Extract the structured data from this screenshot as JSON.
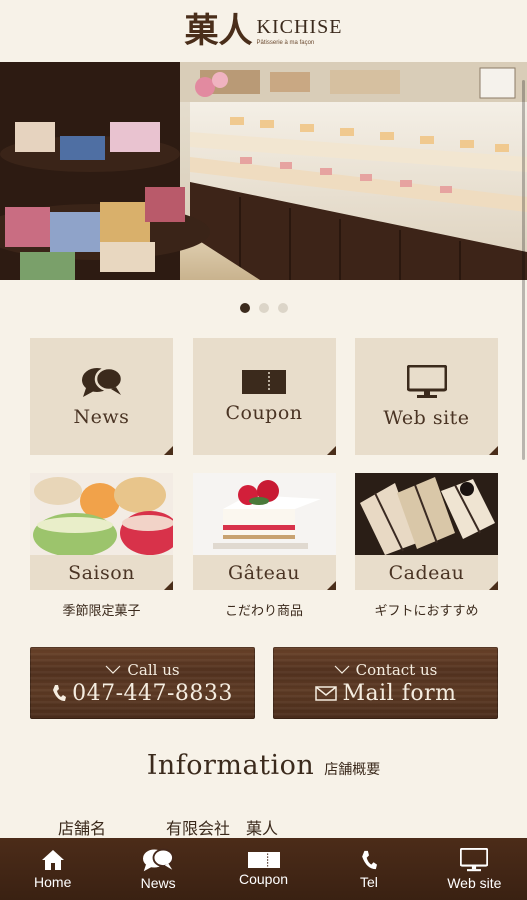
{
  "brand": {
    "logo_kanji": "菓人",
    "name": "KICHISE",
    "tagline": "Pâtisserie à ma façon"
  },
  "hero": {
    "image_alt": "",
    "slides": 3,
    "active_slide": 1
  },
  "menu_tiles": [
    {
      "label": "News",
      "icon": "chat-bubbles-icon"
    },
    {
      "label": "Coupon",
      "icon": "ticket-icon"
    },
    {
      "label": "Web site",
      "icon": "monitor-icon"
    }
  ],
  "category_tiles": [
    {
      "label": "Saison",
      "sub": "季節限定菓子"
    },
    {
      "label": "Gâteau",
      "sub": "こだわり商品"
    },
    {
      "label": "Cadeau",
      "sub": "ギフトにおすすめ"
    }
  ],
  "call_button": {
    "small": "Call us",
    "big": "047-447-8833"
  },
  "mail_button": {
    "small": "Contact us",
    "big": "Mail form"
  },
  "information": {
    "title": "Information",
    "subtitle": "店舗概要",
    "rows": [
      {
        "key": "店舗名",
        "value": "有限会社　菓人"
      }
    ]
  },
  "tabbar": [
    {
      "label": "Home",
      "icon": "home-icon"
    },
    {
      "label": "News",
      "icon": "chat-bubbles-icon"
    },
    {
      "label": "Coupon",
      "icon": "ticket-icon"
    },
    {
      "label": "Tel",
      "icon": "phone-icon"
    },
    {
      "label": "Web site",
      "icon": "monitor-icon"
    }
  ],
  "colors": {
    "background": "#f7f2e8",
    "tile": "#e8ddcb",
    "brown": "#4a2e1a",
    "tabbar": "#3a2112"
  }
}
